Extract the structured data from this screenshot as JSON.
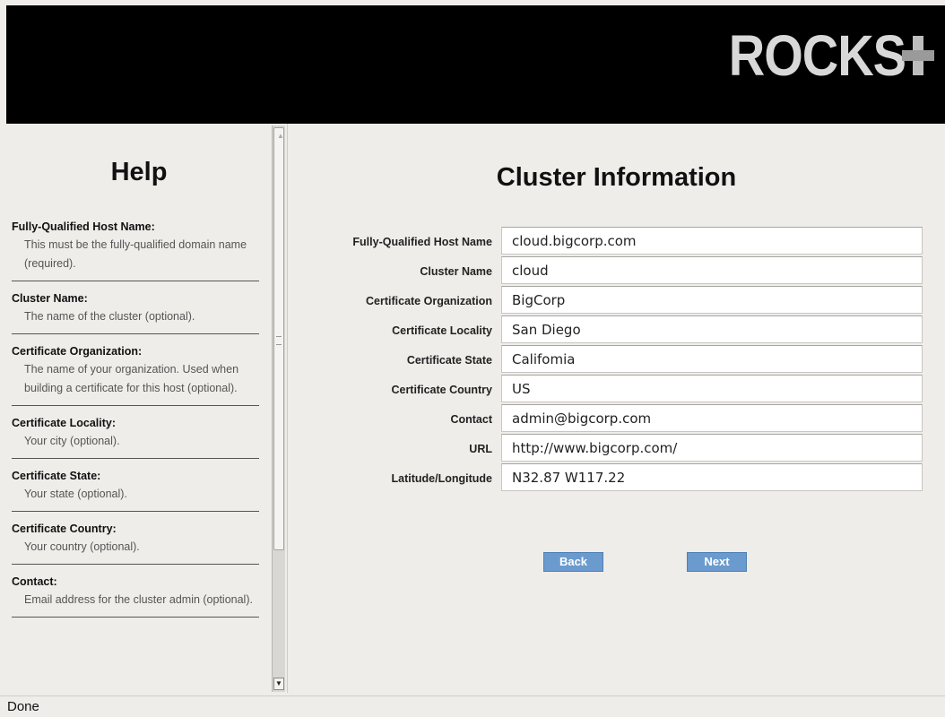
{
  "logo": {
    "text": "ROCKS"
  },
  "help": {
    "title": "Help",
    "entries": [
      {
        "term": "Fully-Qualified Host Name:",
        "desc": "This must be the fully-qualified domain name (required)."
      },
      {
        "term": "Cluster Name:",
        "desc": "The name of the cluster (optional)."
      },
      {
        "term": "Certificate Organization:",
        "desc": "The name of your organization. Used when building a certificate for this host (optional)."
      },
      {
        "term": "Certificate Locality:",
        "desc": "Your city (optional)."
      },
      {
        "term": "Certificate State:",
        "desc": "Your state (optional)."
      },
      {
        "term": "Certificate Country:",
        "desc": "Your country (optional)."
      },
      {
        "term": "Contact:",
        "desc": "Email address for the cluster admin (optional)."
      }
    ]
  },
  "main": {
    "title": "Cluster Information",
    "fields": [
      {
        "label": "Fully-Qualified Host Name",
        "value": "cloud.bigcorp.com"
      },
      {
        "label": "Cluster Name",
        "value": "cloud"
      },
      {
        "label": "Certificate Organization",
        "value": "BigCorp"
      },
      {
        "label": "Certificate Locality",
        "value": "San Diego"
      },
      {
        "label": "Certificate State",
        "value": "Califomia"
      },
      {
        "label": "Certificate Country",
        "value": "US"
      },
      {
        "label": "Contact",
        "value": "admin@bigcorp.com"
      },
      {
        "label": "URL",
        "value": "http://www.bigcorp.com/"
      },
      {
        "label": "Latitude/Longitude",
        "value": "N32.87 W117.22"
      }
    ],
    "back_label": "Back",
    "next_label": "Next"
  },
  "status": {
    "text": "Done"
  }
}
